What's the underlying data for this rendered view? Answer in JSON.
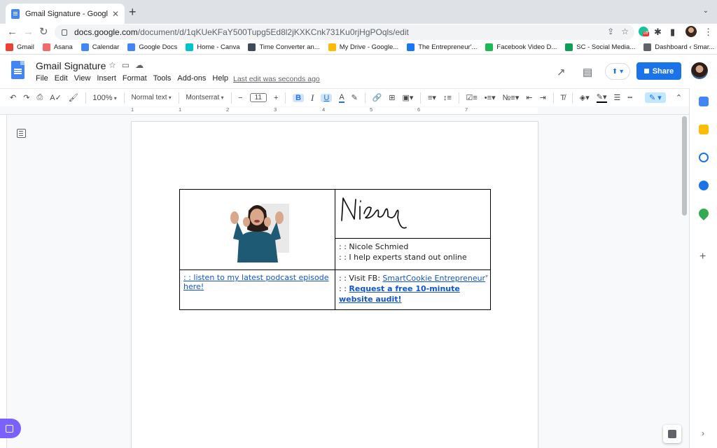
{
  "browser": {
    "tab_title": "Gmail Signature - Google Docs",
    "url_host": "docs.google.com",
    "url_path": "/document/d/1qKUeKFaY500Tupg5Ed8l2jKXKCnk731Ku0rjHgPOqls/edit",
    "bookmarks": [
      {
        "label": "Gmail",
        "color": "#ea4335"
      },
      {
        "label": "Asana",
        "color": "#f06a6a"
      },
      {
        "label": "Calendar",
        "color": "#4285f4"
      },
      {
        "label": "Google Docs",
        "color": "#4285f4"
      },
      {
        "label": "Home - Canva",
        "color": "#00c4cc"
      },
      {
        "label": "Time Converter an...",
        "color": "#3c4a5c"
      },
      {
        "label": "My Drive - Google...",
        "color": "#fbbc04"
      },
      {
        "label": "The Entrepreneur'...",
        "color": "#1877f2"
      },
      {
        "label": "Facebook Video D...",
        "color": "#1db954"
      },
      {
        "label": "SC - Social Media...",
        "color": "#0f9d58"
      },
      {
        "label": "Dashboard ‹ Smar...",
        "color": "#5f6368"
      }
    ]
  },
  "docs": {
    "title": "Gmail Signature",
    "menu": [
      "File",
      "Edit",
      "View",
      "Insert",
      "Format",
      "Tools",
      "Add-ons",
      "Help"
    ],
    "last_edit": "Last edit was seconds ago",
    "share_label": "Share"
  },
  "toolbar": {
    "zoom": "100%",
    "style": "Normal text",
    "font": "Montserrat",
    "font_size": "11",
    "minus": "−",
    "plus": "+",
    "bold": "B",
    "italic": "I",
    "underline": "U",
    "text_color": "A"
  },
  "ruler": {
    "numbers": [
      "1",
      "1",
      "2",
      "3",
      "4",
      "5",
      "6",
      "7"
    ]
  },
  "signature": {
    "name_line": ": : Nicole Schmied",
    "tagline": ": : I help experts stand out online",
    "podcast_link": ": : listen to my latest podcast episode here!",
    "fb_prefix": ": : Visit FB: ",
    "fb_link": "SmartCookie Entrepreneur",
    "audit_prefix": ": : ",
    "audit_link": "Request a free 10-minute website audit!"
  },
  "colors": {
    "accent": "#1a73e8",
    "link": "#1155cc"
  }
}
